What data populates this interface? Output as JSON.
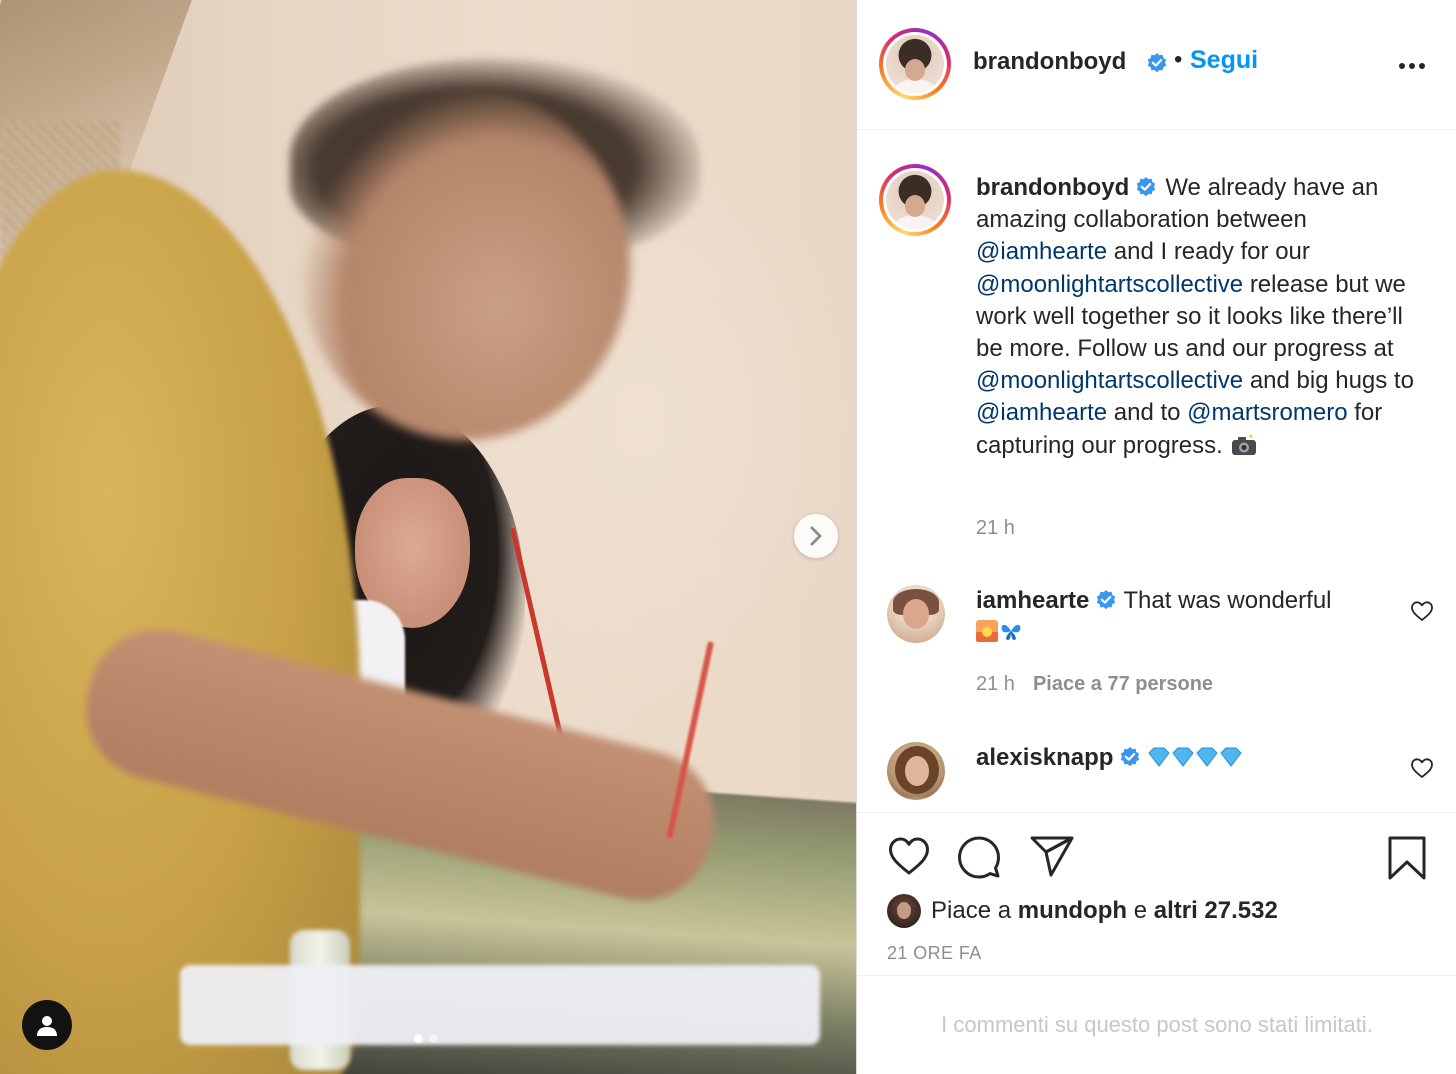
{
  "post": {
    "author": "brandonboyd",
    "follow_separator": "•",
    "follow_label": "Segui",
    "caption": {
      "part1": "We already have an amazing collaboration between",
      "mention1": "@iamhearte",
      "part2": "and I ready for our",
      "mention2": "@moonlightartscollective",
      "part3": "release but we work well together so it looks like there’ll be more. Follow us and our progress at",
      "mention3": "@moonlightartscollective",
      "part4": "and big hugs to",
      "mention4": "@iamhearte",
      "part5": "and to",
      "mention5": "@martsromero",
      "part6": "for capturing our progress."
    },
    "caption_time": "21 h"
  },
  "comments": [
    {
      "username": "iamhearte",
      "text": "That was wonderful",
      "emojis": [
        "sunrise-emoji",
        "butterfly-emoji"
      ],
      "time": "21 h",
      "likes_label": "Piace a 77 persone"
    },
    {
      "username": "alexisknapp",
      "emojis": [
        "gem-emoji",
        "gem-emoji",
        "gem-emoji",
        "gem-emoji"
      ]
    }
  ],
  "likes": {
    "prefix": "Piace a",
    "user": "mundoph",
    "middle": "e",
    "count_label": "altri 27.532"
  },
  "timestamp": "21 ORE FA",
  "comments_limited": "I commenti su questo post sono stati limitati.",
  "carousel": {
    "current": 1,
    "total": 2
  },
  "colors": {
    "link_blue": "#0095f6",
    "mention_blue": "#00376b",
    "verified_blue": "#3897f0",
    "muted": "#8e8e8e"
  }
}
